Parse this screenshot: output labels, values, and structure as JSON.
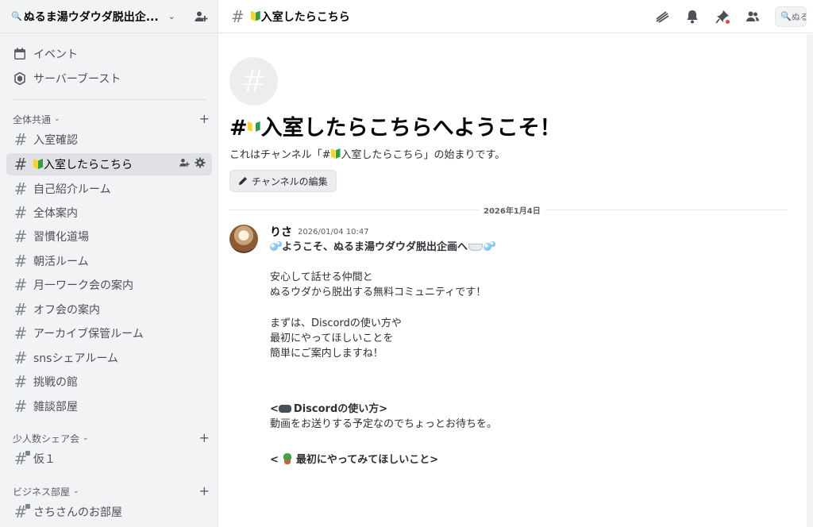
{
  "server": {
    "name": "ぬるま湯ウダウダ脱出企...",
    "search_glyph": "🔍"
  },
  "nav": {
    "events_label": "イベント",
    "boost_label": "サーバーブースト"
  },
  "categories": {
    "common": "全体共通",
    "small": "少人数シェア会",
    "business": "ビジネス部屋"
  },
  "channels": {
    "c1": "入室確認",
    "c2": "入室したらこちら",
    "c3": "自己紹介ルーム",
    "c4": "全体案内",
    "c5": "習慣化道場",
    "c6": "朝活ルーム",
    "c7": "月一ワーク会の案内",
    "c8": "オフ会の案内",
    "c9": "アーカイブ保管ルーム",
    "c10": "snsシェアルーム",
    "c11": "挑戦の館",
    "c12": "雑談部屋",
    "small1": "仮１",
    "biz1": "さちさんのお部屋"
  },
  "topbar": {
    "channel_name": "入室したらこちら",
    "search_placeholder": "ぬる"
  },
  "welcome": {
    "title_prefix": "#",
    "title_rest": "入室したらこちらへようこそ！",
    "sub_prefix": "これはチャンネル「#",
    "sub_suffix": "入室したらこちら」の始まりです。",
    "edit_label": "チャンネルの編集"
  },
  "date_divider": "2026年1月4日",
  "message": {
    "author": "りさ",
    "timestamp": "2026/01/04 10:47",
    "headline": "ようこそ、ぬるま湯ウダウダ脱出企画へ",
    "l1": "安心して話せる仲間と",
    "l2": "ぬるウダから脱出する無料コミュニティです！",
    "l3": "まずは、Discordの使い方や",
    "l4": "最初にやってほしいことを",
    "l5": "簡単にご案内しますね！",
    "s1_prefix": "<",
    "s1_title": "Discordの使い方>",
    "s1_body": "動画をお送りする予定なのでちょっとお待ちを。",
    "s2_prefix": "<",
    "s2_title": "最初にやってみてほしいこと>"
  },
  "icons": {
    "calendar": "calendar-icon",
    "boost": "boost-icon",
    "hash": "#"
  }
}
